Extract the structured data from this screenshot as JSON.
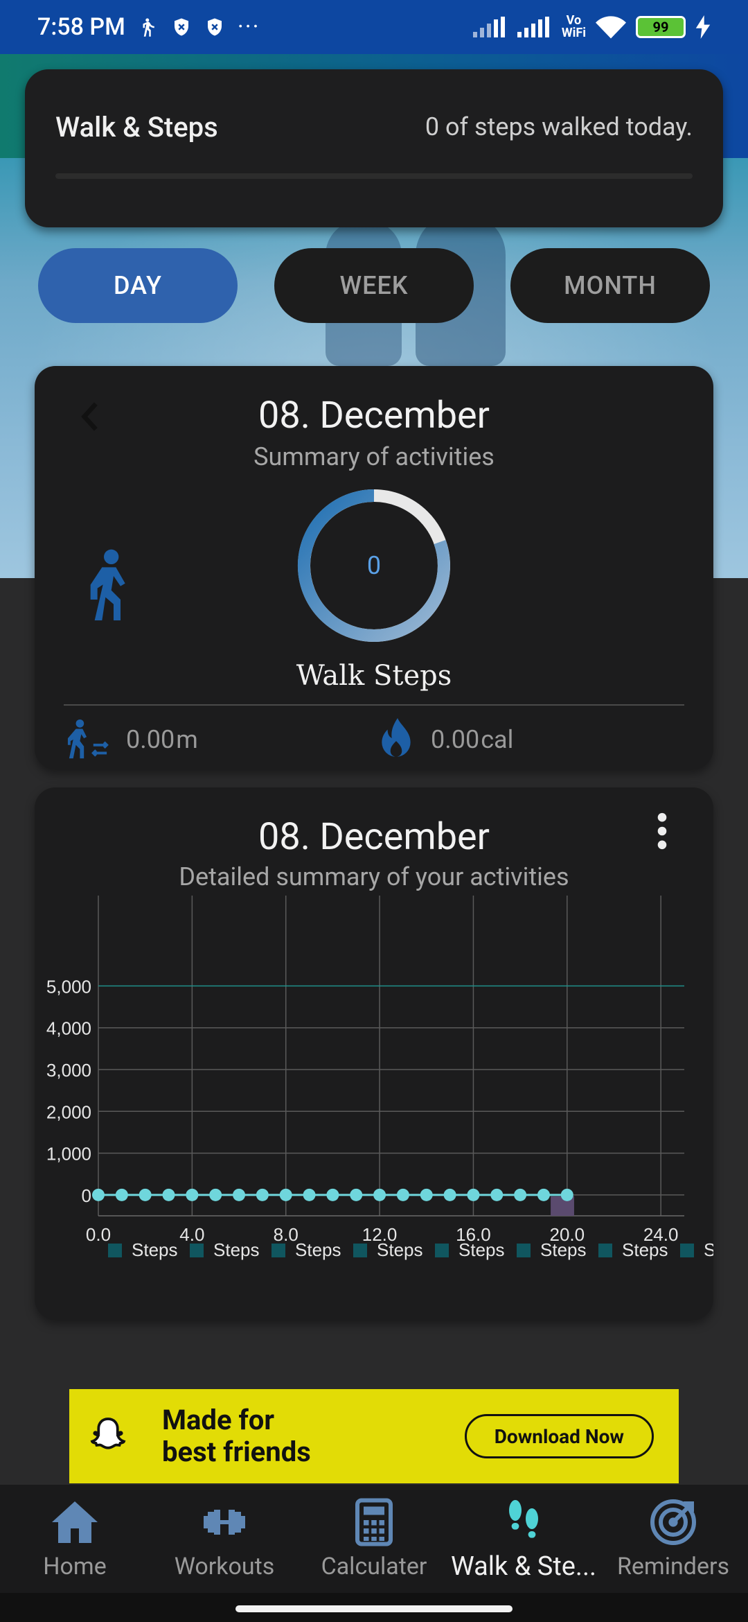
{
  "status_bar": {
    "time": "7:58 PM",
    "battery": "99"
  },
  "summary": {
    "title": "Walk & Steps",
    "steps_today": "0 of steps walked today.",
    "progress_fraction": 0
  },
  "period_tabs": [
    {
      "label": "DAY",
      "active": true
    },
    {
      "label": "WEEK",
      "active": false
    },
    {
      "label": "MONTH",
      "active": false
    }
  ],
  "activity": {
    "date": "08. December",
    "subtitle": "Summary of activities",
    "steps_value": "0",
    "steps_label": "Walk Steps",
    "distance_value": "0.00",
    "distance_unit": "m",
    "calories_value": "0.00",
    "calories_unit": "cal"
  },
  "detail": {
    "date": "08. December",
    "subtitle": "Detailed summary of your activities"
  },
  "chart_data": {
    "type": "line",
    "x": [
      0,
      1,
      2,
      3,
      4,
      5,
      6,
      7,
      8,
      9,
      10,
      11,
      12,
      13,
      14,
      15,
      16,
      17,
      18,
      19,
      20
    ],
    "series": [
      {
        "name": "Steps",
        "values": [
          0,
          0,
          0,
          0,
          0,
          0,
          0,
          0,
          0,
          0,
          0,
          0,
          0,
          0,
          0,
          0,
          0,
          0,
          0,
          0,
          0
        ]
      }
    ],
    "x_ticks": [
      "0.0",
      "4.0",
      "8.0",
      "12.0",
      "16.0",
      "20.0",
      "24.0"
    ],
    "y_ticks": [
      "0",
      "1,000",
      "2,000",
      "3,000",
      "4,000",
      "5,000"
    ],
    "xlim": [
      0,
      25
    ],
    "ylim": [
      -500,
      6500
    ],
    "legend": [
      "Steps",
      "Steps",
      "Steps",
      "Steps",
      "Steps",
      "Steps",
      "Steps",
      "Steps"
    ],
    "legend_placement": "bottom",
    "grid": true,
    "colors": {
      "line": "#6fd6dc",
      "goal_line": "#1f8f8a",
      "highlight_bar": "#5a4a6e"
    }
  },
  "ad": {
    "line1": "Made for",
    "line2": "best friends",
    "cta": "Download Now"
  },
  "bottom_nav": [
    {
      "label": "Home",
      "icon": "home-icon",
      "active": false
    },
    {
      "label": "Workouts",
      "icon": "dumbbell-icon",
      "active": false
    },
    {
      "label": "Calculater",
      "icon": "calculator-icon",
      "active": false
    },
    {
      "label": "Walk & Ste...",
      "icon": "footsteps-icon",
      "active": true
    },
    {
      "label": "Reminders",
      "icon": "target-icon",
      "active": false
    }
  ]
}
